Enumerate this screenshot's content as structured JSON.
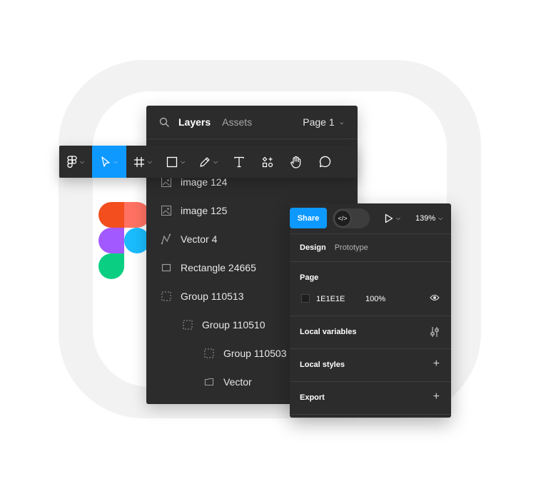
{
  "toolbar": {
    "items": [
      {
        "icon": "figma-menu-icon",
        "active": false,
        "chevron": true
      },
      {
        "icon": "move-tool-icon",
        "active": true,
        "chevron": true
      },
      {
        "icon": "frame-tool-icon",
        "active": false,
        "chevron": true
      },
      {
        "icon": "rectangle-tool-icon",
        "active": false,
        "chevron": true
      },
      {
        "icon": "pen-tool-icon",
        "active": false,
        "chevron": true
      },
      {
        "icon": "text-tool-icon",
        "active": false,
        "chevron": false
      },
      {
        "icon": "resources-icon",
        "active": false,
        "chevron": false
      },
      {
        "icon": "hand-tool-icon",
        "active": false,
        "chevron": false
      },
      {
        "icon": "comment-tool-icon",
        "active": false,
        "chevron": false
      }
    ],
    "accent": "#0d99ff"
  },
  "layers_panel": {
    "tab_layers": "Layers",
    "tab_assets": "Assets",
    "page_selector": "Page 1",
    "rows": [
      {
        "name": "image 124",
        "icon": "image-icon"
      },
      {
        "name": "image 125",
        "icon": "image-icon"
      },
      {
        "name": "Vector 4",
        "icon": "vector-icon"
      },
      {
        "name": "Rectangle 24665",
        "icon": "rectangle-icon"
      },
      {
        "name": "Group 110513",
        "icon": "group-icon"
      },
      {
        "name": "Group 110510",
        "icon": "group-icon"
      },
      {
        "name": "Group 110503",
        "icon": "group-icon"
      },
      {
        "name": "Vector",
        "icon": "folder-icon"
      }
    ]
  },
  "design_panel": {
    "share_label": "Share",
    "dev_mode_icon": "code-icon",
    "zoom": "139%",
    "tab_design": "Design",
    "tab_prototype": "Prototype",
    "page_section_title": "Page",
    "page_color_hex": "1E1E1E",
    "page_opacity": "100%",
    "local_variables": "Local variables",
    "local_styles": "Local styles",
    "export": "Export"
  },
  "colors": {
    "panel_bg": "#2c2c2c",
    "accent": "#0d99ff",
    "canvas_color": "#1e1e1e",
    "logo_red": "#f24e1e",
    "logo_orange": "#ff7262",
    "logo_purple": "#a259ff",
    "logo_blue": "#1abcfe",
    "logo_green": "#0acf83"
  }
}
